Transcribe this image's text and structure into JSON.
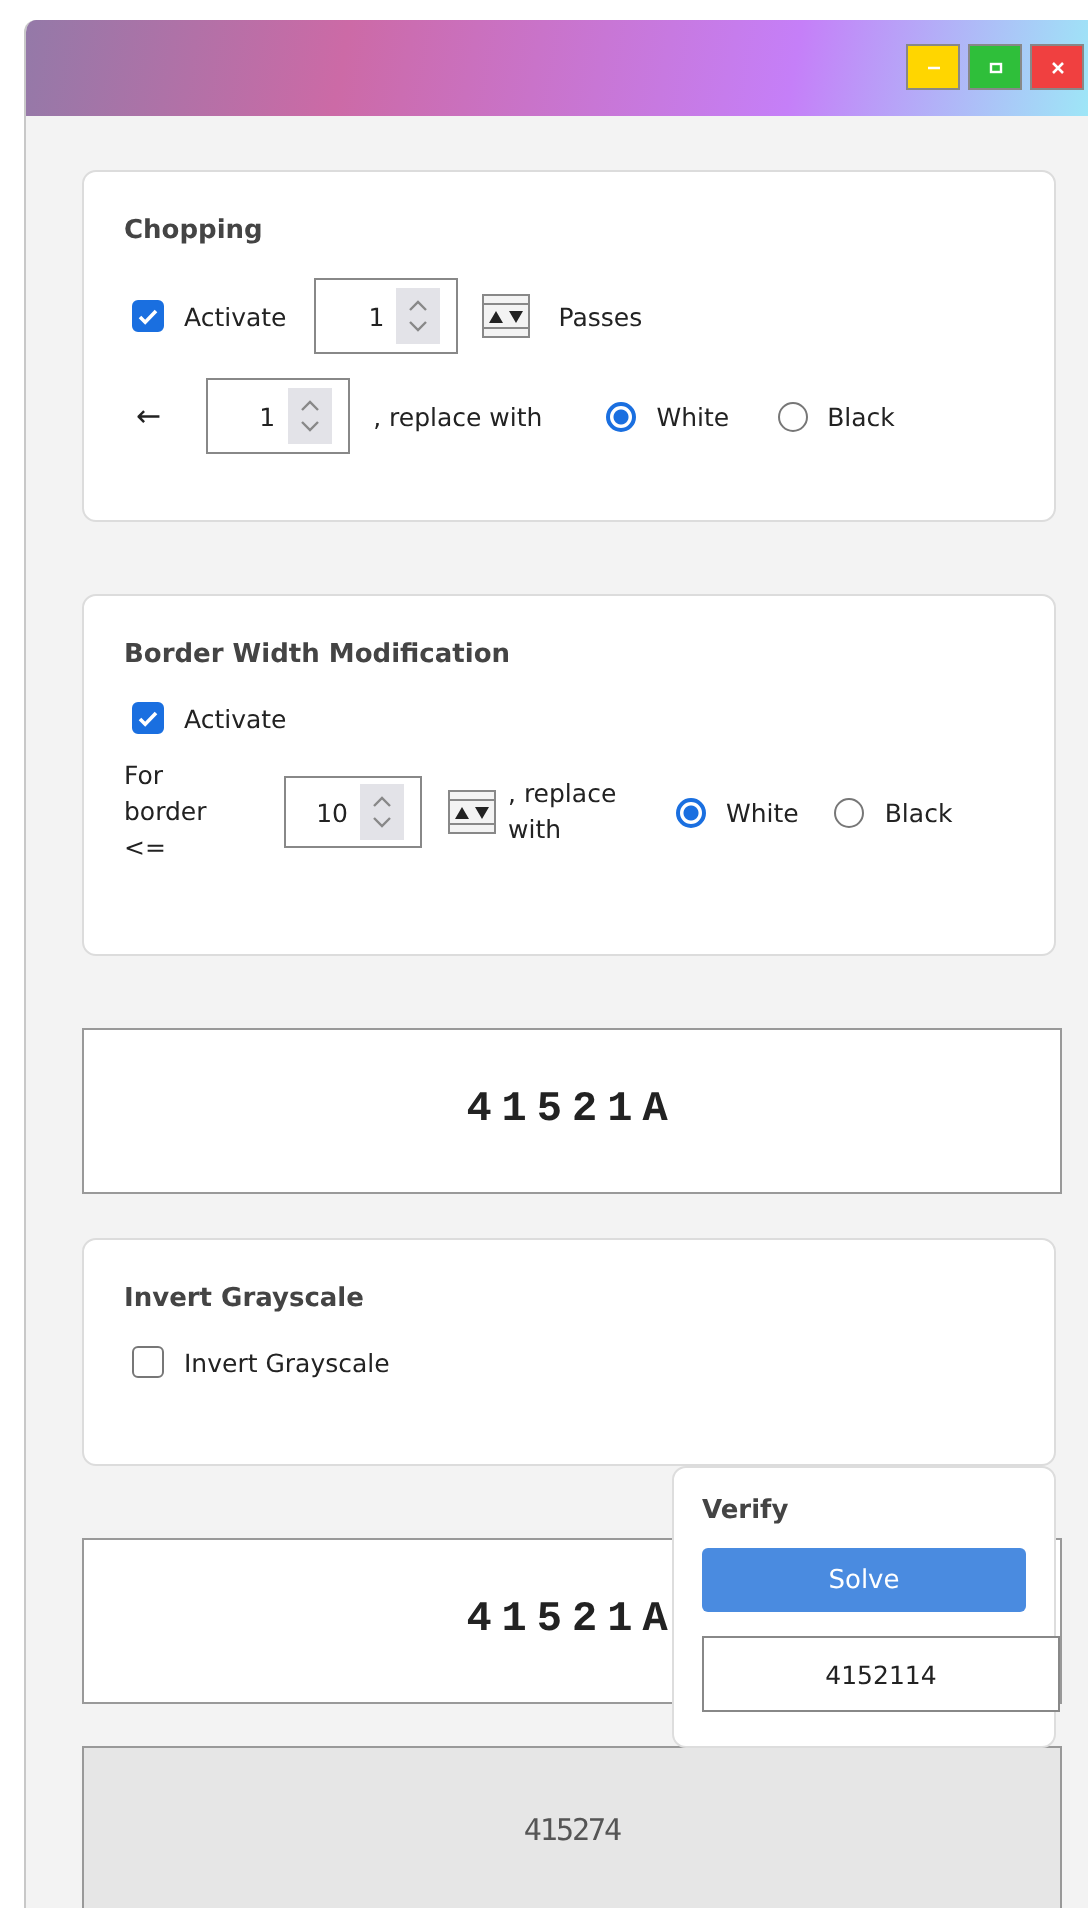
{
  "window": {
    "controls": [
      {
        "kind": "minimize"
      },
      {
        "kind": "maximize"
      },
      {
        "kind": "close"
      }
    ]
  },
  "chopping": {
    "title": "Chopping",
    "activate": {
      "label": "Activate",
      "checked": true
    },
    "passes": {
      "value": "1",
      "label": "Passes"
    },
    "arrow": "←",
    "pixels": {
      "value": "1"
    },
    "replace_label": ", replace with",
    "options": [
      {
        "label": "White",
        "selected": true
      },
      {
        "label": "Black",
        "selected": false
      }
    ]
  },
  "border": {
    "title": "Border Width Modification",
    "activate": {
      "label": "Activate",
      "checked": true
    },
    "for_label": "For border <=",
    "width": {
      "value": "10"
    },
    "replace_label": ", replace with",
    "options": [
      {
        "label": "White",
        "selected": true
      },
      {
        "label": "Black",
        "selected": false
      }
    ]
  },
  "captcha_1": {
    "text": "41521A"
  },
  "invert": {
    "title": "Invert Grayscale",
    "checkbox": {
      "label": "Invert Grayscale",
      "checked": false
    }
  },
  "captcha_2": {
    "text": "41521A"
  },
  "verify": {
    "title": "Verify",
    "button": "Solve",
    "result": "4152114"
  },
  "captcha_3": {
    "text": "415274"
  }
}
